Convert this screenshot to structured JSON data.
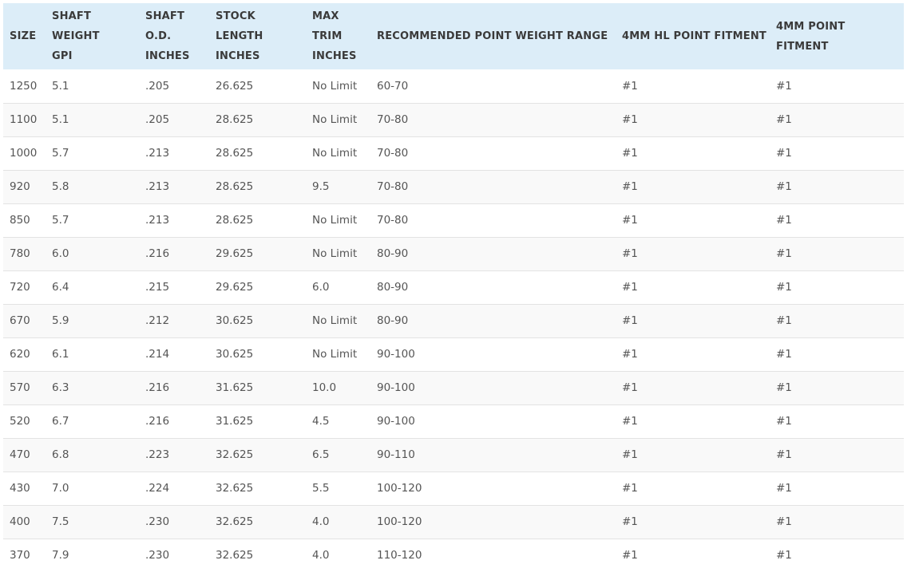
{
  "table": {
    "headers": [
      [
        "SIZE"
      ],
      [
        "SHAFT",
        "WEIGHT",
        "GPI"
      ],
      [
        "SHAFT",
        "O.D.",
        "INCHES"
      ],
      [
        "STOCK",
        "LENGTH",
        "INCHES"
      ],
      [
        "MAX",
        "TRIM",
        "INCHES"
      ],
      [
        "RECOMMENDED POINT WEIGHT RANGE"
      ],
      [
        "4MM HL POINT FITMENT"
      ],
      [
        "4MM POINT FITMENT"
      ]
    ],
    "rows": [
      [
        "1250",
        "5.1",
        ".205",
        "26.625",
        "No Limit",
        "60-70",
        "#1",
        "#1"
      ],
      [
        "1100",
        "5.1",
        ".205",
        "28.625",
        "No Limit",
        "70-80",
        "#1",
        "#1"
      ],
      [
        "1000",
        "5.7",
        ".213",
        "28.625",
        "No Limit",
        "70-80",
        "#1",
        "#1"
      ],
      [
        "920",
        "5.8",
        ".213",
        "28.625",
        "9.5",
        "70-80",
        "#1",
        "#1"
      ],
      [
        "850",
        "5.7",
        ".213",
        "28.625",
        "No Limit",
        "70-80",
        "#1",
        "#1"
      ],
      [
        "780",
        "6.0",
        ".216",
        "29.625",
        "No Limit",
        "80-90",
        "#1",
        "#1"
      ],
      [
        "720",
        "6.4",
        ".215",
        "29.625",
        "6.0",
        "80-90",
        "#1",
        "#1"
      ],
      [
        "670",
        "5.9",
        ".212",
        "30.625",
        "No Limit",
        "80-90",
        "#1",
        "#1"
      ],
      [
        "620",
        "6.1",
        ".214",
        "30.625",
        "No Limit",
        "90-100",
        "#1",
        "#1"
      ],
      [
        "570",
        "6.3",
        ".216",
        "31.625",
        "10.0",
        "90-100",
        "#1",
        "#1"
      ],
      [
        "520",
        "6.7",
        ".216",
        "31.625",
        "4.5",
        "90-100",
        "#1",
        "#1"
      ],
      [
        "470",
        "6.8",
        ".223",
        "32.625",
        "6.5",
        "90-110",
        "#1",
        "#1"
      ],
      [
        "430",
        "7.0",
        ".224",
        "32.625",
        "5.5",
        "100-120",
        "#1",
        "#1"
      ],
      [
        "400",
        "7.5",
        ".230",
        "32.625",
        "4.0",
        "100-120",
        "#1",
        "#1"
      ],
      [
        "370",
        "7.9",
        ".230",
        "32.625",
        "4.0",
        "110-120",
        "#1",
        "#1"
      ]
    ]
  },
  "colors": {
    "header_bg": "#dcedf8",
    "row_alt_bg": "#f9f9f9",
    "border": "#e3e3e3"
  }
}
